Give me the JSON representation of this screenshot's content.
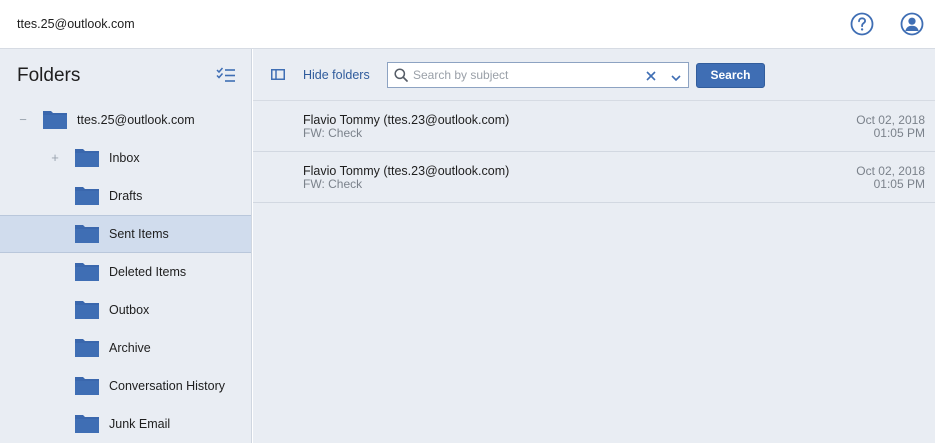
{
  "header": {
    "account_email": "ttes.25@outlook.com",
    "icons": [
      "help-icon",
      "user-profile-icon"
    ]
  },
  "sidebar": {
    "title": "Folders",
    "root": {
      "label": "ttes.25@outlook.com",
      "expander": "−"
    },
    "folders": [
      {
        "label": "Inbox",
        "expander": "+"
      },
      {
        "label": "Drafts",
        "expander": ""
      },
      {
        "label": "Sent Items",
        "expander": "",
        "selected": true
      },
      {
        "label": "Deleted Items",
        "expander": ""
      },
      {
        "label": "Outbox",
        "expander": ""
      },
      {
        "label": "Archive",
        "expander": ""
      },
      {
        "label": "Conversation History",
        "expander": ""
      },
      {
        "label": "Junk Email",
        "expander": ""
      }
    ]
  },
  "toolbar": {
    "hide_folders_label": "Hide folders",
    "search_placeholder": "Search by subject",
    "search_value": "",
    "search_button_label": "Search"
  },
  "messages": [
    {
      "from": "Flavio Tommy (ttes.23@outlook.com)",
      "subject": "FW: Check",
      "date": "Oct 02, 2018",
      "time": "01:05 PM"
    },
    {
      "from": "Flavio Tommy (ttes.23@outlook.com)",
      "subject": "FW: Check",
      "date": "Oct 02, 2018",
      "time": "01:05 PM"
    }
  ],
  "colors": {
    "accent": "#3f6eb4",
    "folder_icon": "#3a67ad",
    "sidebar_bg": "#e9edf3",
    "selected_bg": "#d0dced"
  }
}
